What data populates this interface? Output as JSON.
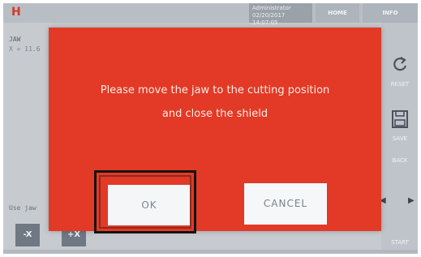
{
  "header": {
    "logo": "H",
    "user": {
      "name": "Administrator",
      "date": "02/20/2017",
      "time": "14:07:05"
    },
    "tabs": [
      {
        "label": "HOME"
      },
      {
        "label": "INFO"
      }
    ]
  },
  "left_panel": {
    "title": "JAW",
    "coord": "X = 11.6",
    "hint": "Use jaw",
    "buttons": [
      {
        "label": "-X"
      },
      {
        "label": "+X"
      }
    ]
  },
  "right_panel": {
    "reset_label": "RESET",
    "save_label": "SAVE",
    "back_label": "BACK",
    "start_label": "START"
  },
  "dialog": {
    "message_line1": "Please move the jaw to the cutting position",
    "message_line2": "and close the shield",
    "ok_label": "OK",
    "cancel_label": "CANCEL"
  },
  "colors": {
    "dialog_background": "#e23a26",
    "screen_background": "#c7cbd0"
  }
}
